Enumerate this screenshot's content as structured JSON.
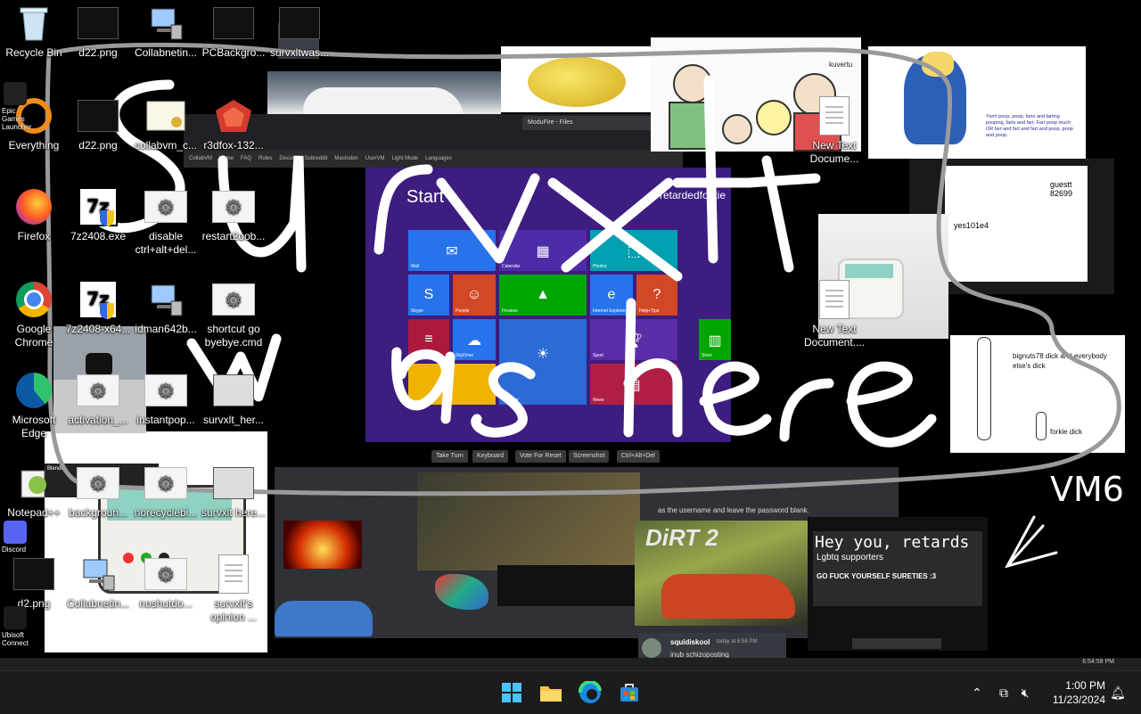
{
  "desktop": {
    "icons": [
      {
        "label": "Recycle Bin"
      },
      {
        "label": "d22.png"
      },
      {
        "label": "Collabnetin..."
      },
      {
        "label": "PCBackgro..."
      },
      {
        "label": "survxltwas..."
      },
      {
        "label": "Everything"
      },
      {
        "label": "d22.png"
      },
      {
        "label": "collabvm_c..."
      },
      {
        "label": "r3dfox-132..."
      },
      {
        "label": "Firefox"
      },
      {
        "label": "7z2408.exe"
      },
      {
        "label": "disable ctrl+alt+del..."
      },
      {
        "label": "restart2oob..."
      },
      {
        "label": "Google Chrome"
      },
      {
        "label": "7z2408-x64..."
      },
      {
        "label": "idman642b..."
      },
      {
        "label": "shortcut go byebye.cmd"
      },
      {
        "label": "Microsoft Edge"
      },
      {
        "label": "activation_..."
      },
      {
        "label": "instantpop..."
      },
      {
        "label": "survxlt_her..."
      },
      {
        "label": "Notepad++"
      },
      {
        "label": "backgroun..."
      },
      {
        "label": "norecyclebi..."
      },
      {
        "label": "survxlt here..."
      },
      {
        "label": "d2.png"
      },
      {
        "label": "Collabnetin..."
      },
      {
        "label": "noshutdo..."
      },
      {
        "label": "survxlt's opinion ..."
      },
      {
        "label": "New Text Docume..."
      },
      {
        "label": "New Text Document...."
      }
    ],
    "mini_icons": [
      {
        "label": "Epic Games Launcher"
      },
      {
        "label": "Discord"
      },
      {
        "label": "Ubisoft Connect"
      }
    ]
  },
  "wallpaper": {
    "scribble_text": [
      "survxlt",
      "was here"
    ],
    "vm_label": "VM6",
    "browser_tab": "ModuFire - Files",
    "browser_nav": [
      "CollabVM",
      "Home",
      "FAQ",
      "Rules",
      "Discord",
      "Subreddit",
      "Mastodon",
      "UserVM",
      "Light Mode",
      "Languages"
    ],
    "start_title": "Start",
    "start_user": "retardedforkie",
    "tiles": [
      "Mail",
      "Calendar",
      "Photos",
      "Skype",
      "People",
      "Finance",
      "Internet Explorer",
      "Help+Tips",
      "Reading List",
      "SkyDrive",
      "Sport",
      "Weather",
      "News",
      "Store"
    ],
    "vm_buttons": [
      "Take Turn",
      "Keyboard",
      "Vote For Reset",
      "Screenshot",
      "Ctrl+Alt+Del"
    ],
    "comic_names": [
      "kuvertu"
    ],
    "meme_text": "Yum! poop, poop, farts and farting pooping, farts and fart. Fart poop much OR fart and fart and fart and poop, poop and poop.",
    "chat_names": [
      "guestt 82699",
      "yes101e4"
    ],
    "dick_text_1": "bignuts78 dick and everybody else's dick",
    "dick_text_2": "forkie dick",
    "hey_title": "Hey you, retards",
    "hey_sub": "Lgbtq supporters",
    "hey_line": "GO FUCK YOURSELF SURETIES :3",
    "tip_text": "as the username and leave the password blank.",
    "game_title": "DiRT 2",
    "chat_user": "squidiskool",
    "chat_time": "today at 6:58 PM",
    "chat_message": "inub schizoposting",
    "vm_clock": "6:54:58 PM"
  },
  "taskbar": {
    "time": "1:00 PM",
    "date": "11/23/2024"
  },
  "colors": {
    "scribble": "#ffffff",
    "border_scribble": "#9a9a9a",
    "start_bg": "#3d1d7f",
    "taskbar_bg": "#1c1c1c"
  }
}
